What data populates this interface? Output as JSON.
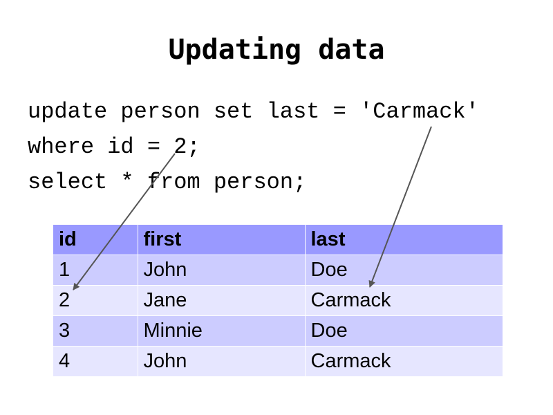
{
  "slide": {
    "title": "Updating data"
  },
  "code": {
    "lines": [
      "update person set last = 'Carmack'",
      "where id = 2;",
      "select * from person;"
    ]
  },
  "table": {
    "headers": [
      "id",
      "first",
      "last"
    ],
    "rows": [
      [
        "1",
        "John",
        "Doe"
      ],
      [
        "2",
        "Jane",
        "Carmack"
      ],
      [
        "3",
        "Minnie",
        "Doe"
      ],
      [
        "4",
        "John",
        "Carmack"
      ]
    ]
  },
  "colors": {
    "header_bg": "#9999ff",
    "row_odd_bg": "#ccccff",
    "row_even_bg": "#e6e6ff",
    "arrow": "#555555"
  }
}
